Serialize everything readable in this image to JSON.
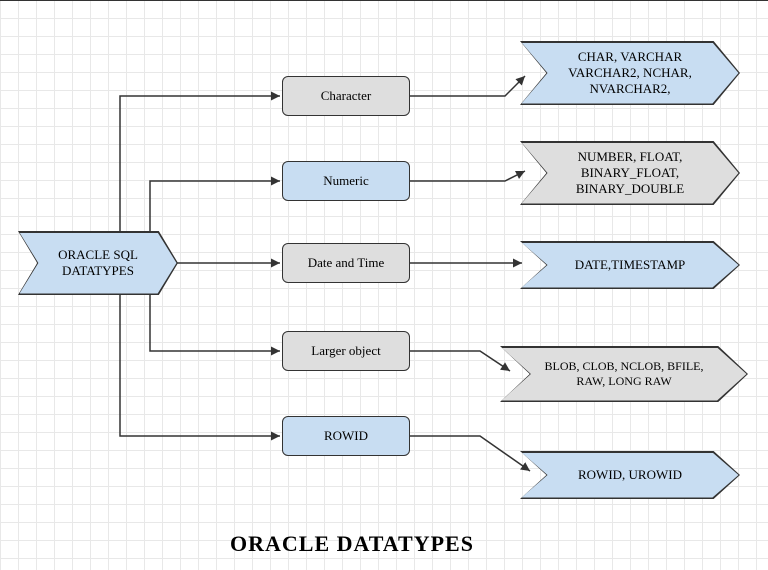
{
  "title": "ORACLE DATATYPES",
  "root": {
    "label": "ORACLE SQL\nDATATYPES"
  },
  "categories": [
    {
      "label": "Character",
      "types": "CHAR, VARCHAR\nVARCHAR2, NCHAR,\nNVARCHAR2,"
    },
    {
      "label": "Numeric",
      "types": "NUMBER, FLOAT,\nBINARY_FLOAT,\nBINARY_DOUBLE"
    },
    {
      "label": "Date and Time",
      "types": "DATE,TIMESTAMP"
    },
    {
      "label": "Larger object",
      "types": "BLOB, CLOB, NCLOB, BFILE,\nRAW, LONG RAW"
    },
    {
      "label": "ROWID",
      "types": "ROWID, UROWID"
    }
  ]
}
